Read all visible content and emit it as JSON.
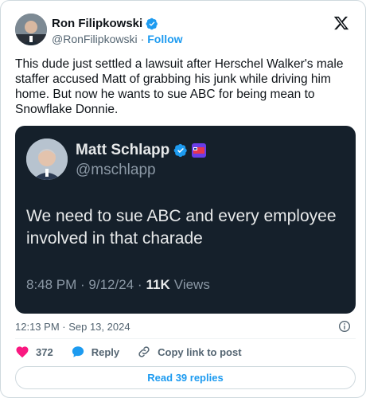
{
  "author": {
    "name": "Ron Filipkowski",
    "handle": "@RonFilipkowski",
    "separator": "·",
    "follow_label": "Follow"
  },
  "tweet": {
    "text": "This dude just settled a lawsuit after Herschel Walker's male staffer accused Matt of grabbing his junk while driving him home. But now he wants to sue ABC for being mean to Snowflake Donnie.",
    "timestamp": "12:13 PM · Sep 13, 2024"
  },
  "quoted_tweet": {
    "name": "Matt Schlapp",
    "handle": "@mschlapp",
    "text": "We need to sue ABC and every employee involved in that charade",
    "time": "8:48 PM · 9/12/24 ·",
    "views_count": "11K",
    "views_label": "Views",
    "badge_text": "CPAC"
  },
  "actions": {
    "likes": "372",
    "reply_label": "Reply",
    "copy_link_label": "Copy link to post"
  },
  "read_replies_label": "Read 39 replies",
  "colors": {
    "accent": "#1d9bf0",
    "like": "#f91880",
    "quote_bg": "#15202b"
  }
}
